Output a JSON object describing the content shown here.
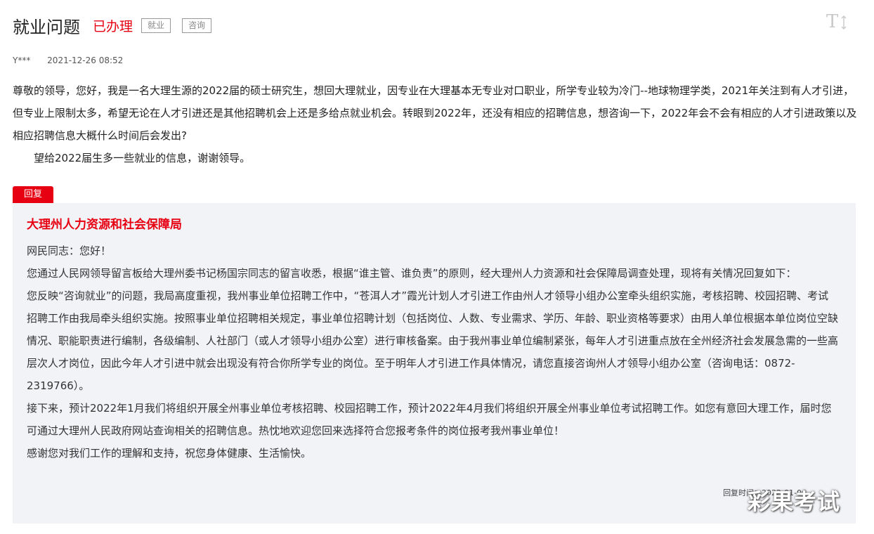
{
  "header": {
    "title": "就业问题",
    "status": "已办理",
    "tags": [
      "就业",
      "咨询"
    ],
    "font_toggle_label": "T"
  },
  "meta": {
    "author": "Y***",
    "date": "2021-12-26 08:52"
  },
  "question": {
    "paragraphs": [
      "尊敬的领导，您好，我是一名大理生源的2022届的硕士研究生，想回大理就业，因专业在大理基本无专业对口职业，所学专业较为冷门--地球物理学类，2021年关注到有人才引进，但专业上限制太多，希望无论在人才引进还是其他招聘机会上还是多给点就业机会。转眼到2022年，还没有相应的招聘信息，想咨询一下，2022年会不会有相应的人才引进政策以及相应招聘信息大概什么时间后会发出?",
      "望给2022届生多一些就业的信息，谢谢领导。"
    ]
  },
  "reply": {
    "badge": "回复",
    "department": "大理州人力资源和社会保障局",
    "paragraphs": [
      "网民同志：您好！",
      "您通过人民网领导留言板给大理州委书记杨国宗同志的留言收悉，根据“谁主管、谁负责”的原则，经大理州人力资源和社会保障局调查处理，现将有关情况回复如下：",
      "您反映“咨询就业”的问题，我局高度重视，我州事业单位招聘工作中，“苍洱人才”霞光计划人才引进工作由州人才领导小组办公室牵头组织实施，考核招聘、校园招聘、考试招聘工作由我局牵头组织实施。按照事业单位招聘相关规定，事业单位招聘计划（包括岗位、人数、专业需求、学历、年龄、职业资格等要求）由用人单位根据本单位岗位空缺情况、职能职责进行编制，各级编制、人社部门（或人才领导小组办公室）进行审核备案。由于我州事业单位编制紧张，每年人才引进重点放在全州经济社会发展急需的一些高层次人才岗位，因此今年人才引进中就会出现没有符合你所学专业的岗位。至于明年人才引进工作具体情况，请您直接咨询州人才领导小组办公室（咨询电话：0872-2319766）。",
      "接下来，预计2022年1月我们将组织开展全州事业单位考核招聘、校园招聘工作，预计2022年4月我们将组织开展全州事业单位考试招聘工作。如您有意回大理工作，届时您可通过大理州人民政府网站查询相关的招聘信息。热忱地欢迎您回来选择符合您报考条件的岗位报考我州事业单位！",
      "感谢您对我们工作的理解和支持，祝您身体健康、生活愉快。"
    ],
    "time_label": "回复时间：2022-01-06"
  },
  "watermark": "彩果考试"
}
